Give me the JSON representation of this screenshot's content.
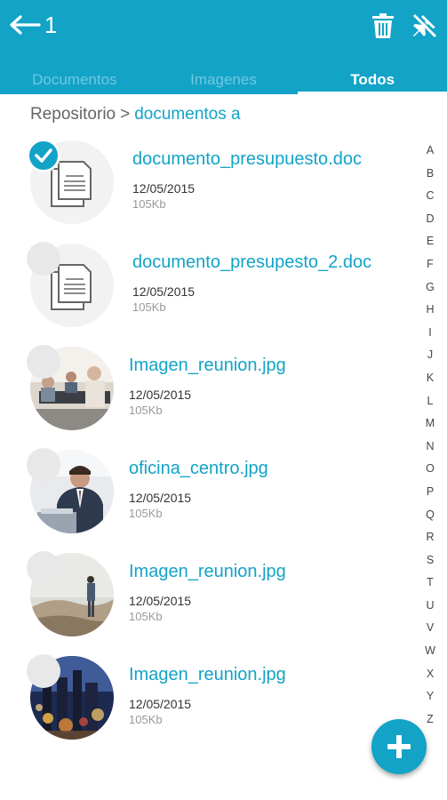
{
  "header": {
    "selected_count": "1",
    "back_icon": "arrow-left-icon",
    "delete_icon": "trash-icon",
    "unpin_icon": "pin-off-icon",
    "color": "#12a3c7"
  },
  "tabs": [
    {
      "label": "Documentos",
      "active": false
    },
    {
      "label": "Imagenes",
      "active": false
    },
    {
      "label": "Todos",
      "active": true
    }
  ],
  "breadcrumb": {
    "root": "Repositorio",
    "separator": ">",
    "current": "documentos a"
  },
  "files": [
    {
      "name": "documento_presupuesto.doc",
      "date": "12/05/2015",
      "size": "105Kb",
      "type": "document",
      "selected": true
    },
    {
      "name": "documento_presupesto_2.doc",
      "date": "12/05/2015",
      "size": "105Kb",
      "type": "document",
      "selected": false
    },
    {
      "name": "Imagen_reunion.jpg",
      "date": "12/05/2015",
      "size": "105Kb",
      "type": "image",
      "selected": false
    },
    {
      "name": "oficina_centro.jpg",
      "date": "12/05/2015",
      "size": "105Kb",
      "type": "image",
      "selected": false
    },
    {
      "name": "Imagen_reunion.jpg",
      "date": "12/05/2015",
      "size": "105Kb",
      "type": "image",
      "selected": false
    },
    {
      "name": "Imagen_reunion.jpg",
      "date": "12/05/2015",
      "size": "105Kb",
      "type": "image",
      "selected": false
    }
  ],
  "alphabet": [
    "A",
    "B",
    "C",
    "D",
    "E",
    "F",
    "G",
    "H",
    "I",
    "J",
    "K",
    "L",
    "M",
    "N",
    "O",
    "P",
    "Q",
    "R",
    "S",
    "T",
    "U",
    "V",
    "W",
    "X",
    "Y",
    "Z"
  ],
  "fab": {
    "icon": "plus-icon"
  }
}
